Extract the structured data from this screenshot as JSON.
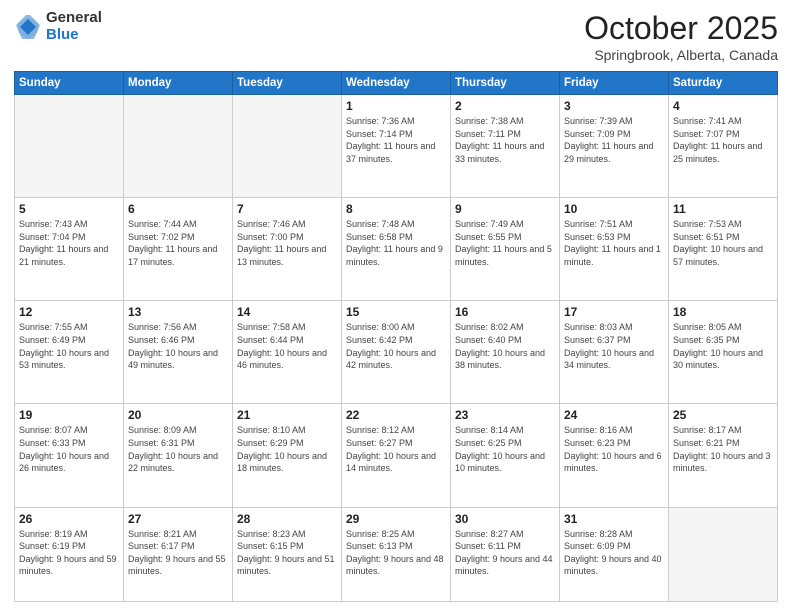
{
  "logo": {
    "general": "General",
    "blue": "Blue"
  },
  "header": {
    "month": "October 2025",
    "location": "Springbrook, Alberta, Canada"
  },
  "weekdays": [
    "Sunday",
    "Monday",
    "Tuesday",
    "Wednesday",
    "Thursday",
    "Friday",
    "Saturday"
  ],
  "weeks": [
    [
      {
        "day": "",
        "sunrise": "",
        "sunset": "",
        "daylight": ""
      },
      {
        "day": "",
        "sunrise": "",
        "sunset": "",
        "daylight": ""
      },
      {
        "day": "",
        "sunrise": "",
        "sunset": "",
        "daylight": ""
      },
      {
        "day": "1",
        "sunrise": "Sunrise: 7:36 AM",
        "sunset": "Sunset: 7:14 PM",
        "daylight": "Daylight: 11 hours and 37 minutes."
      },
      {
        "day": "2",
        "sunrise": "Sunrise: 7:38 AM",
        "sunset": "Sunset: 7:11 PM",
        "daylight": "Daylight: 11 hours and 33 minutes."
      },
      {
        "day": "3",
        "sunrise": "Sunrise: 7:39 AM",
        "sunset": "Sunset: 7:09 PM",
        "daylight": "Daylight: 11 hours and 29 minutes."
      },
      {
        "day": "4",
        "sunrise": "Sunrise: 7:41 AM",
        "sunset": "Sunset: 7:07 PM",
        "daylight": "Daylight: 11 hours and 25 minutes."
      }
    ],
    [
      {
        "day": "5",
        "sunrise": "Sunrise: 7:43 AM",
        "sunset": "Sunset: 7:04 PM",
        "daylight": "Daylight: 11 hours and 21 minutes."
      },
      {
        "day": "6",
        "sunrise": "Sunrise: 7:44 AM",
        "sunset": "Sunset: 7:02 PM",
        "daylight": "Daylight: 11 hours and 17 minutes."
      },
      {
        "day": "7",
        "sunrise": "Sunrise: 7:46 AM",
        "sunset": "Sunset: 7:00 PM",
        "daylight": "Daylight: 11 hours and 13 minutes."
      },
      {
        "day": "8",
        "sunrise": "Sunrise: 7:48 AM",
        "sunset": "Sunset: 6:58 PM",
        "daylight": "Daylight: 11 hours and 9 minutes."
      },
      {
        "day": "9",
        "sunrise": "Sunrise: 7:49 AM",
        "sunset": "Sunset: 6:55 PM",
        "daylight": "Daylight: 11 hours and 5 minutes."
      },
      {
        "day": "10",
        "sunrise": "Sunrise: 7:51 AM",
        "sunset": "Sunset: 6:53 PM",
        "daylight": "Daylight: 11 hours and 1 minute."
      },
      {
        "day": "11",
        "sunrise": "Sunrise: 7:53 AM",
        "sunset": "Sunset: 6:51 PM",
        "daylight": "Daylight: 10 hours and 57 minutes."
      }
    ],
    [
      {
        "day": "12",
        "sunrise": "Sunrise: 7:55 AM",
        "sunset": "Sunset: 6:49 PM",
        "daylight": "Daylight: 10 hours and 53 minutes."
      },
      {
        "day": "13",
        "sunrise": "Sunrise: 7:56 AM",
        "sunset": "Sunset: 6:46 PM",
        "daylight": "Daylight: 10 hours and 49 minutes."
      },
      {
        "day": "14",
        "sunrise": "Sunrise: 7:58 AM",
        "sunset": "Sunset: 6:44 PM",
        "daylight": "Daylight: 10 hours and 46 minutes."
      },
      {
        "day": "15",
        "sunrise": "Sunrise: 8:00 AM",
        "sunset": "Sunset: 6:42 PM",
        "daylight": "Daylight: 10 hours and 42 minutes."
      },
      {
        "day": "16",
        "sunrise": "Sunrise: 8:02 AM",
        "sunset": "Sunset: 6:40 PM",
        "daylight": "Daylight: 10 hours and 38 minutes."
      },
      {
        "day": "17",
        "sunrise": "Sunrise: 8:03 AM",
        "sunset": "Sunset: 6:37 PM",
        "daylight": "Daylight: 10 hours and 34 minutes."
      },
      {
        "day": "18",
        "sunrise": "Sunrise: 8:05 AM",
        "sunset": "Sunset: 6:35 PM",
        "daylight": "Daylight: 10 hours and 30 minutes."
      }
    ],
    [
      {
        "day": "19",
        "sunrise": "Sunrise: 8:07 AM",
        "sunset": "Sunset: 6:33 PM",
        "daylight": "Daylight: 10 hours and 26 minutes."
      },
      {
        "day": "20",
        "sunrise": "Sunrise: 8:09 AM",
        "sunset": "Sunset: 6:31 PM",
        "daylight": "Daylight: 10 hours and 22 minutes."
      },
      {
        "day": "21",
        "sunrise": "Sunrise: 8:10 AM",
        "sunset": "Sunset: 6:29 PM",
        "daylight": "Daylight: 10 hours and 18 minutes."
      },
      {
        "day": "22",
        "sunrise": "Sunrise: 8:12 AM",
        "sunset": "Sunset: 6:27 PM",
        "daylight": "Daylight: 10 hours and 14 minutes."
      },
      {
        "day": "23",
        "sunrise": "Sunrise: 8:14 AM",
        "sunset": "Sunset: 6:25 PM",
        "daylight": "Daylight: 10 hours and 10 minutes."
      },
      {
        "day": "24",
        "sunrise": "Sunrise: 8:16 AM",
        "sunset": "Sunset: 6:23 PM",
        "daylight": "Daylight: 10 hours and 6 minutes."
      },
      {
        "day": "25",
        "sunrise": "Sunrise: 8:17 AM",
        "sunset": "Sunset: 6:21 PM",
        "daylight": "Daylight: 10 hours and 3 minutes."
      }
    ],
    [
      {
        "day": "26",
        "sunrise": "Sunrise: 8:19 AM",
        "sunset": "Sunset: 6:19 PM",
        "daylight": "Daylight: 9 hours and 59 minutes."
      },
      {
        "day": "27",
        "sunrise": "Sunrise: 8:21 AM",
        "sunset": "Sunset: 6:17 PM",
        "daylight": "Daylight: 9 hours and 55 minutes."
      },
      {
        "day": "28",
        "sunrise": "Sunrise: 8:23 AM",
        "sunset": "Sunset: 6:15 PM",
        "daylight": "Daylight: 9 hours and 51 minutes."
      },
      {
        "day": "29",
        "sunrise": "Sunrise: 8:25 AM",
        "sunset": "Sunset: 6:13 PM",
        "daylight": "Daylight: 9 hours and 48 minutes."
      },
      {
        "day": "30",
        "sunrise": "Sunrise: 8:27 AM",
        "sunset": "Sunset: 6:11 PM",
        "daylight": "Daylight: 9 hours and 44 minutes."
      },
      {
        "day": "31",
        "sunrise": "Sunrise: 8:28 AM",
        "sunset": "Sunset: 6:09 PM",
        "daylight": "Daylight: 9 hours and 40 minutes."
      },
      {
        "day": "",
        "sunrise": "",
        "sunset": "",
        "daylight": ""
      }
    ]
  ]
}
